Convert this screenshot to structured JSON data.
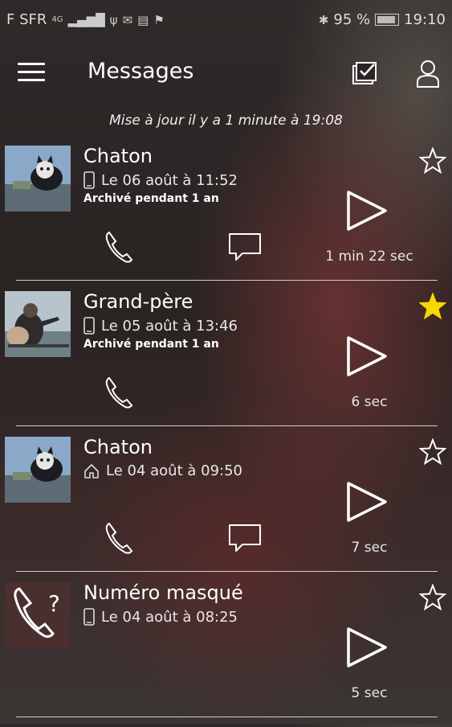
{
  "statusbar": {
    "carrier": "F SFR",
    "network": "4G",
    "battery": "95 %",
    "time": "19:10"
  },
  "appbar": {
    "title": "Messages"
  },
  "update_text": "Mise à jour il y a 1 minute à 19:08",
  "messages": [
    {
      "name": "Chaton",
      "date": "Le 06 août à 11:52",
      "source": "phone-icon",
      "archived": "Archivé pendant 1 an",
      "duration": "1 min 22 sec",
      "starred": false,
      "has_message_button": true,
      "thumb": "kitten-photo"
    },
    {
      "name": "Grand-père",
      "date": "Le 05 août à 13:46",
      "source": "phone-icon",
      "archived": "Archivé pendant 1 an",
      "duration": "6 sec",
      "starred": true,
      "has_message_button": false,
      "thumb": "grandpa-photo"
    },
    {
      "name": "Chaton",
      "date": "Le 04 août à 09:50",
      "source": "home-icon",
      "archived": "",
      "duration": "7 sec",
      "starred": false,
      "has_message_button": true,
      "thumb": "kitten-photo"
    },
    {
      "name": "Numéro masqué",
      "date": "Le 04 août à 08:25",
      "source": "phone-icon",
      "archived": "",
      "duration": "5 sec",
      "starred": false,
      "has_message_button": false,
      "thumb": "unknown-caller"
    }
  ],
  "colors": {
    "star_active": "#f5d800",
    "text": "#ffffff",
    "divider": "#cfcfcf"
  }
}
